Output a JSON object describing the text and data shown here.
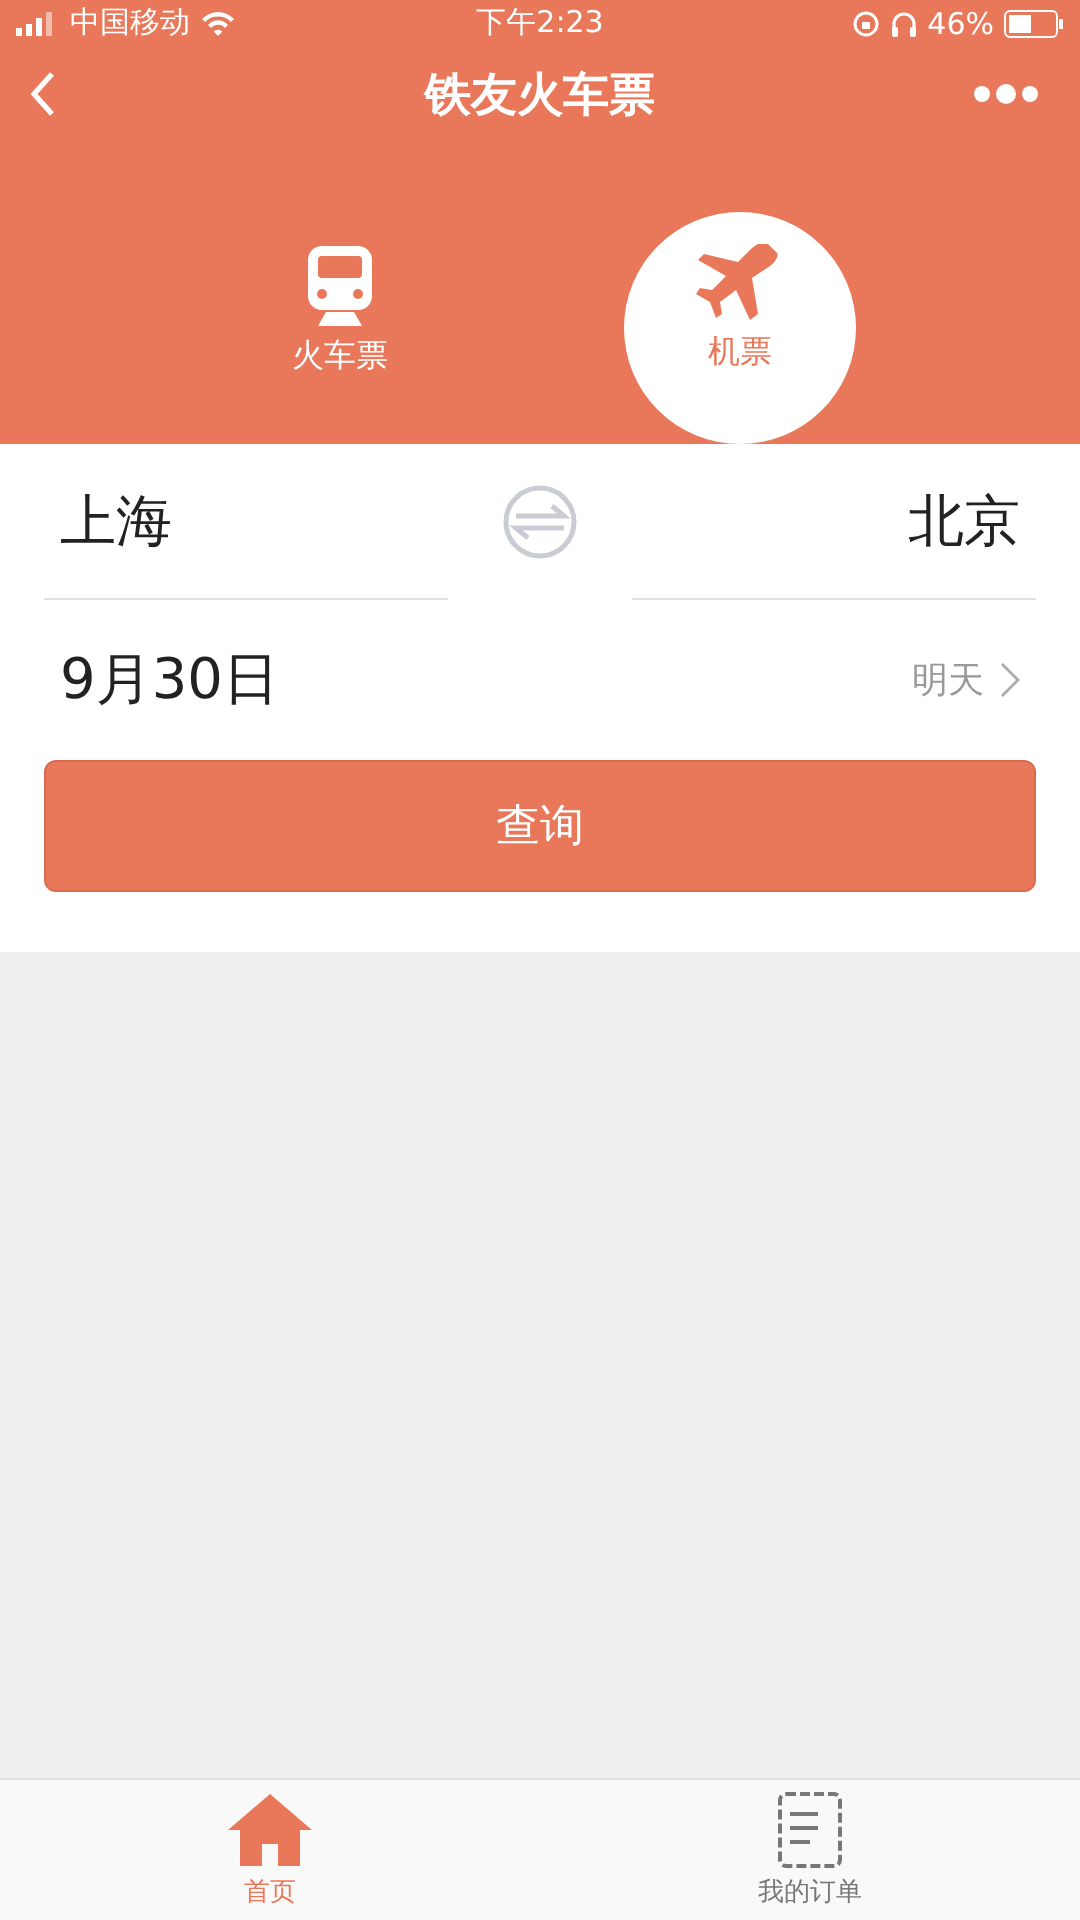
{
  "status_bar": {
    "carrier": "中国移动",
    "time": "下午2:23",
    "battery": "46%"
  },
  "nav": {
    "title": "铁友火车票"
  },
  "modes": [
    {
      "kind": "train",
      "label": "火车票",
      "selected": false
    },
    {
      "kind": "plane",
      "label": "机票",
      "selected": true
    }
  ],
  "form": {
    "from": "上海",
    "to": "北京",
    "date": "9月30日",
    "date_hint": "明天",
    "search_button": "查询"
  },
  "tab_bar": [
    {
      "kind": "home",
      "label": "首页",
      "selected": true
    },
    {
      "kind": "orders",
      "label": "我的订单",
      "selected": false
    }
  ]
}
